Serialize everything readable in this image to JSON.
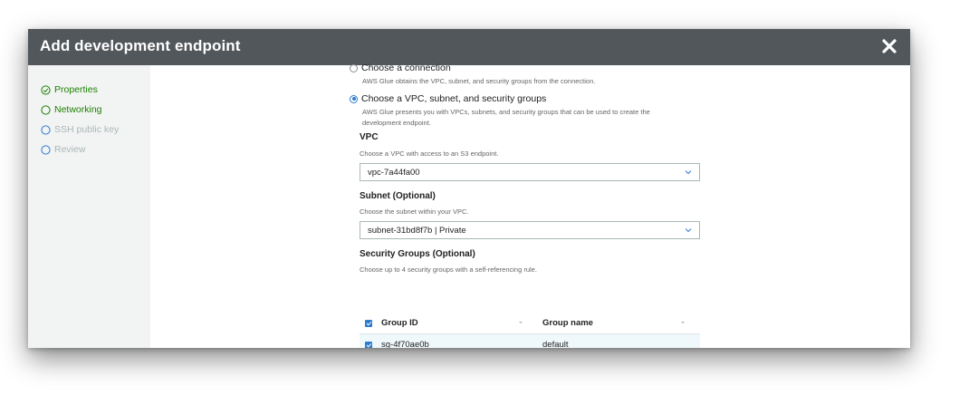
{
  "dialog": {
    "title": "Add development endpoint",
    "close_label": "close"
  },
  "sidebar": {
    "steps": [
      {
        "label": "Properties",
        "state": "done"
      },
      {
        "label": "Networking",
        "state": "current"
      },
      {
        "label": "SSH public key",
        "state": "upcoming"
      },
      {
        "label": "Review",
        "state": "upcoming"
      }
    ]
  },
  "network": {
    "options": [
      {
        "label": "Choose a connection",
        "description": "AWS Glue obtains the VPC, subnet, and security groups from the connection.",
        "selected": false
      },
      {
        "label": "Choose a VPC, subnet, and security groups",
        "description": "AWS Glue presents you with VPCs, subnets, and security groups that can be used to create the development endpoint.",
        "selected": true
      }
    ],
    "vpc": {
      "label": "VPC",
      "hint": "Choose a VPC with access to an S3 endpoint.",
      "value": "vpc-7a44fa00"
    },
    "subnet": {
      "label": "Subnet (Optional)",
      "hint": "Choose the subnet within your VPC.",
      "value": "subnet-31bd8f7b | Private"
    },
    "security_groups": {
      "label": "Security Groups (Optional)",
      "hint": "Choose up to 4 security groups with a self-referencing rule.",
      "columns": [
        "Group ID",
        "Group name"
      ],
      "rows": [
        {
          "group_id": "sg-4f70ae0b",
          "group_name": "default",
          "checked": true
        }
      ]
    }
  },
  "colors": {
    "header_bg": "#52575c",
    "done_green": "#1d8102",
    "accent_blue": "#2e7bcf",
    "muted": "#aab7b8"
  }
}
